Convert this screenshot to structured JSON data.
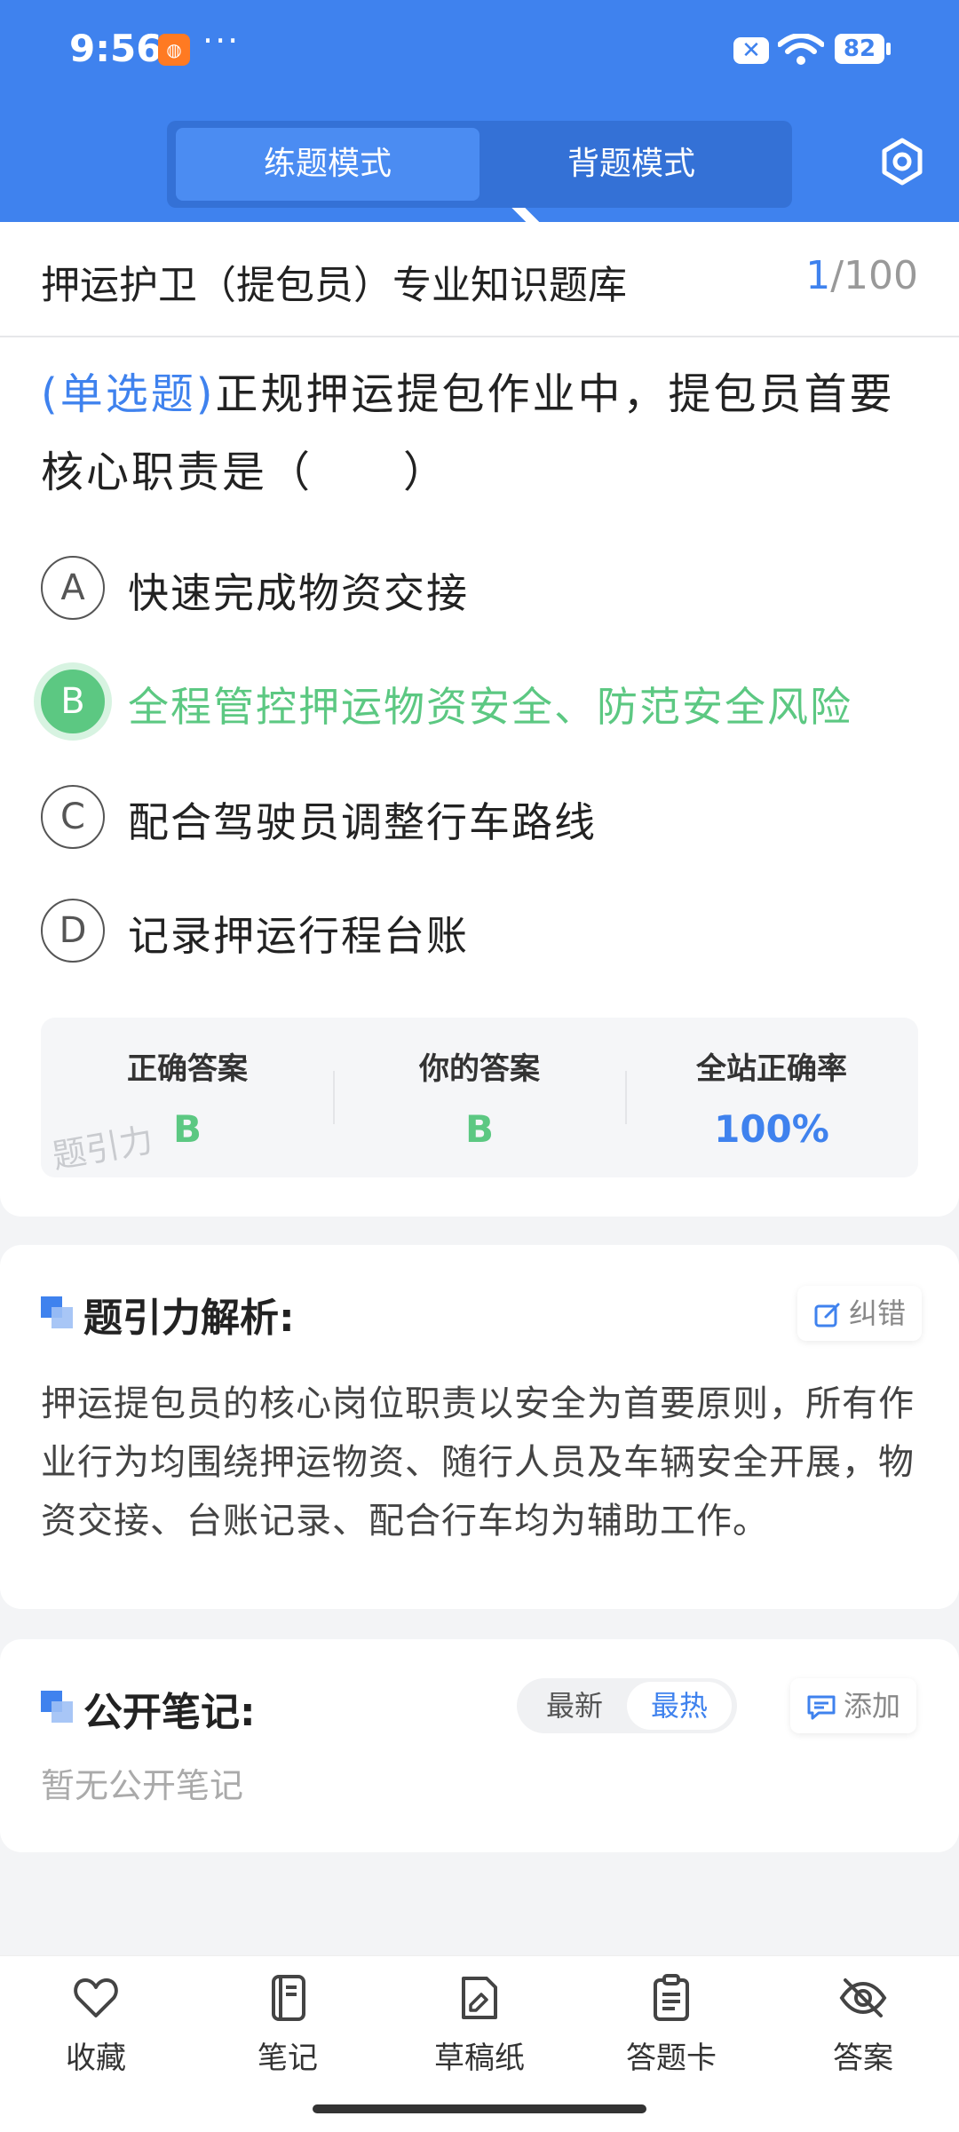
{
  "status_bar": {
    "time": "9:56",
    "battery": "82"
  },
  "header": {
    "tabs": [
      {
        "label": "练题模式",
        "active": true
      },
      {
        "label": "背题模式",
        "active": false
      }
    ]
  },
  "quiz": {
    "bank_title": "押运护卫（提包员）专业知识题库",
    "current": "1",
    "total": "/100",
    "question_type": "(单选题)",
    "question_text": "正规押运提包作业中，提包员首要核心职责是（　　）",
    "options": [
      {
        "letter": "A",
        "text": "快速完成物资交接",
        "state": "normal"
      },
      {
        "letter": "B",
        "text": "全程管控押运物资安全、防范安全风险",
        "state": "correct"
      },
      {
        "letter": "C",
        "text": "配合驾驶员调整行车路线",
        "state": "normal"
      },
      {
        "letter": "D",
        "text": "记录押运行程台账",
        "state": "normal"
      }
    ],
    "answer_summary": {
      "correct_label": "正确答案",
      "correct_value": "B",
      "yours_label": "你的答案",
      "yours_value": "B",
      "rate_label": "全站正确率",
      "rate_value": "100%"
    },
    "watermark": "题引力"
  },
  "analysis": {
    "title": "题引力解析:",
    "report_button": "纠错",
    "text": "押运提包员的核心岗位职责以安全为首要原则，所有作业行为均围绕押运物资、随行人员及车辆安全开展，物资交接、台账记录、配合行车均为辅助工作。"
  },
  "notes": {
    "title": "公开笔记:",
    "sort_new": "最新",
    "sort_hot": "最热",
    "add_button": "添加",
    "empty_text": "暂无公开笔记"
  },
  "bottom_nav": [
    {
      "label": "收藏",
      "icon": "heart-icon"
    },
    {
      "label": "笔记",
      "icon": "notebook-icon"
    },
    {
      "label": "草稿纸",
      "icon": "draft-icon"
    },
    {
      "label": "答题卡",
      "icon": "clipboard-icon"
    },
    {
      "label": "答案",
      "icon": "eye-off-icon"
    }
  ],
  "colors": {
    "primary": "#3f82ee",
    "correct": "#5cc882"
  }
}
